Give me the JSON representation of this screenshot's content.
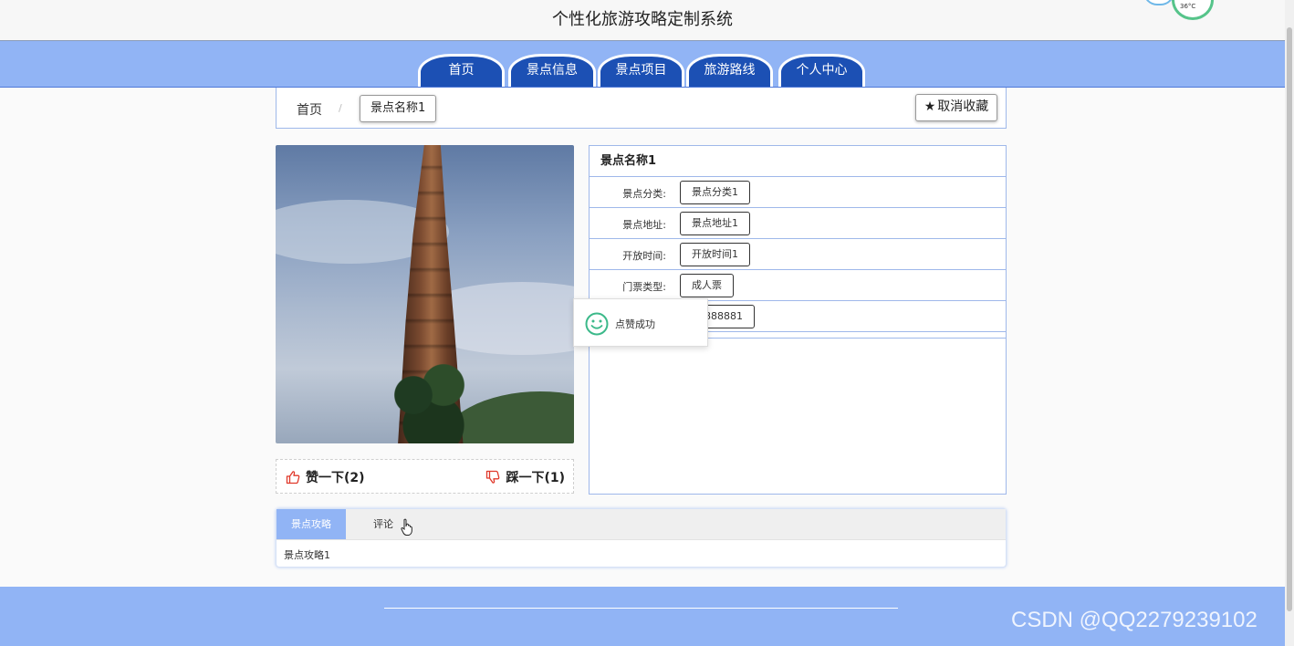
{
  "header": {
    "title": "个性化旅游攻略定制系统"
  },
  "status_widget": {
    "temperature": "36°C"
  },
  "nav": {
    "tabs": [
      {
        "label": "首页"
      },
      {
        "label": "景点信息"
      },
      {
        "label": "景点项目"
      },
      {
        "label": "旅游路线"
      },
      {
        "label": "个人中心"
      }
    ]
  },
  "breadcrumb": {
    "home": "首页",
    "separator": "/",
    "current": "景点名称1"
  },
  "favorite_button": {
    "label": "取消收藏",
    "icon": "star-icon"
  },
  "votes": {
    "like_label": "赞一下(2)",
    "dislike_label": "踩一下(1)"
  },
  "info": {
    "name": "景点名称1",
    "rows": [
      {
        "label": "景点分类:",
        "value": "景点分类1"
      },
      {
        "label": "景点地址:",
        "value": "景点地址1"
      },
      {
        "label": "开放时间:",
        "value": "开放时间1"
      },
      {
        "label": "门票类型:",
        "value": "成人票"
      },
      {
        "label": "",
        "value": "23888881"
      }
    ]
  },
  "toast": {
    "message": "点赞成功",
    "icon": "smile-icon"
  },
  "tabs": {
    "items": [
      {
        "label": "景点攻略"
      },
      {
        "label": "评论"
      }
    ],
    "active_content": "景点攻略1"
  },
  "watermark": "CSDN @QQ2279239102",
  "colors": {
    "nav_band": "#91b4f5",
    "nav_tab": "#1c50b4",
    "border": "#9fb8ea",
    "like_icon": "#e0392b"
  }
}
